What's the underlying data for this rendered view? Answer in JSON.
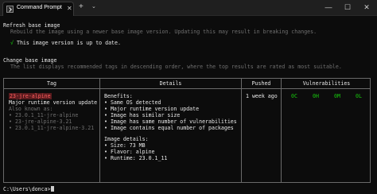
{
  "window": {
    "tab_title": "Command Prompt",
    "new_tab_glyph": "+",
    "dropdown_glyph": "⌄",
    "close_tab_glyph": "✕",
    "minimize_glyph": "—",
    "maximize_glyph": "☐",
    "close_glyph": "✕"
  },
  "refresh": {
    "heading": "Refresh base image",
    "description": "Rebuild the image using a newer base image version. Updating this may result in breaking changes.",
    "check": "√",
    "status": "This image version is up to date."
  },
  "change": {
    "heading": "Change base image",
    "description": "The list displays recommended tags in descending order, where the top results are rated as most suitable."
  },
  "table": {
    "headers": [
      "Tag",
      "Details",
      "Pushed",
      "Vulnerabilities"
    ],
    "row": {
      "tag": "23-jre-alpine",
      "tag_desc": "Major runtime version update",
      "also_known_as": "Also known as:",
      "aliases": [
        "• 23.0.1_11-jre-alpine",
        "• 23-jre-alpine-3.21",
        "• 23.0.1_11-jre-alpine-3.21"
      ],
      "benefits_title": "Benefits:",
      "benefits": [
        "• Same OS detected",
        "• Major runtime version update",
        "• Image has similar size",
        "• Image has same number of vulnerabilities",
        "• Image contains equal number of packages"
      ],
      "details_title": "Image details:",
      "details": [
        "• Size: 73 MB",
        "• Flavor: alpine",
        "• Runtime: 23.0.1_11"
      ],
      "pushed": "1 week ago",
      "vulns": [
        "0C",
        "0H",
        "0M",
        "0L"
      ]
    }
  },
  "prompt": "C:\\Users\\donca>"
}
